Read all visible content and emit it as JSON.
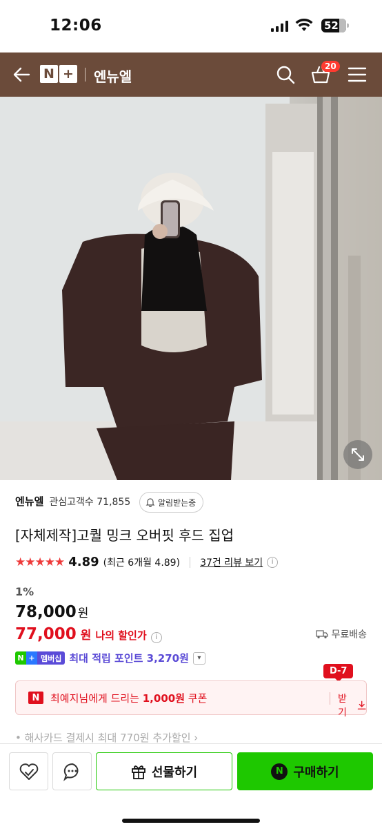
{
  "status": {
    "time": "12:06",
    "battery": "52"
  },
  "appbar": {
    "logo_n": "N",
    "logo_plus": "+",
    "store_name": "엔뉴엘",
    "cart_count": "20"
  },
  "product": {
    "seller": "엔뉴엘",
    "fans_label": "관심고객수 71,855",
    "alarm_label": "알림받는중",
    "title": "[자체제작]고퀄 밍크 오버핏 후드 집업",
    "stars": "★★★★★",
    "rating": "4.89",
    "recent_rating": "(최근 6개월 4.89)",
    "review_link": "37건 리뷰 보기",
    "discount_rate": "1%",
    "price": "78,000",
    "price_unit": "원",
    "my_price": "77,000",
    "my_price_unit": "원",
    "my_price_label": "나의 할인가",
    "shipping": "무료배송",
    "membership_badge": "멤버십",
    "points_text": "최대 적립 포인트 3,270원",
    "coupon_dday": "D-7",
    "coupon_msg_pre": "최예지님에게 드리는 ",
    "coupon_msg_amount": "1,000원",
    "coupon_msg_post": " 쿠폰",
    "coupon_get": "받기",
    "card_promo": "• 해사카드 결제시 최대 770원 추가할인 ›"
  },
  "bottom": {
    "gift_label": "선물하기",
    "buy_label": "구매하기",
    "buy_icon": "N"
  },
  "colors": {
    "brand_brown": "#6b4b3a",
    "naver_green": "#1ec800",
    "sale_red": "#e0101e",
    "points_purple": "#5b4bd6"
  }
}
